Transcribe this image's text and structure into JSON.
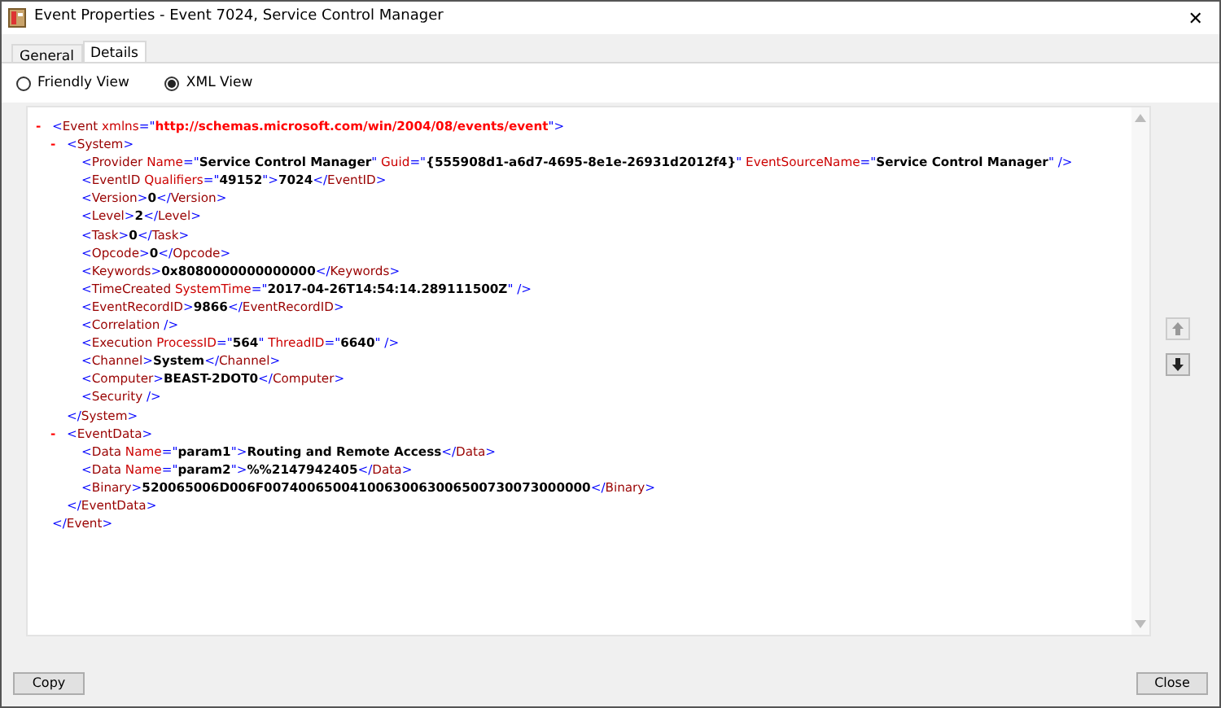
{
  "window": {
    "title": "Event Properties - Event 7024, Service Control Manager",
    "close": "✕"
  },
  "tabs": [
    {
      "label": "General",
      "selected": false
    },
    {
      "label": "Details",
      "selected": true
    }
  ],
  "view_options": [
    {
      "label": "Friendly View",
      "selected": false
    },
    {
      "label": "XML View",
      "selected": true
    }
  ],
  "xml": [
    {
      "toggle": "-",
      "expanded": true,
      "parts": [
        {
          "kind": "punct",
          "text": "<"
        },
        {
          "kind": "tag",
          "text": "Event "
        },
        {
          "kind": "attr",
          "text": "xmlns"
        },
        {
          "kind": "punct",
          "text": "=\""
        },
        {
          "kind": "ns",
          "text": "http://schemas.microsoft.com/win/2004/08/events/event"
        },
        {
          "kind": "punct",
          "text": "\">"
        }
      ],
      "end": [
        {
          "kind": "punct",
          "text": "</"
        },
        {
          "kind": "tag",
          "text": "Event"
        },
        {
          "kind": "punct",
          "text": ">"
        }
      ],
      "children": [
        {
          "toggle": "-",
          "expanded": true,
          "parts": [
            {
              "kind": "punct",
              "text": "<"
            },
            {
              "kind": "tag",
              "text": "System"
            },
            {
              "kind": "punct",
              "text": ">"
            }
          ],
          "end": [
            {
              "kind": "punct",
              "text": "</"
            },
            {
              "kind": "tag",
              "text": "System"
            },
            {
              "kind": "punct",
              "text": ">"
            }
          ],
          "children": [
            {
              "parts": [
                {
                  "kind": "punct",
                  "text": "<"
                },
                {
                  "kind": "tag",
                  "text": "Provider "
                },
                {
                  "kind": "attr",
                  "text": "Name"
                },
                {
                  "kind": "punct",
                  "text": "=\""
                },
                {
                  "kind": "value",
                  "text": "Service Control Manager"
                },
                {
                  "kind": "punct",
                  "text": "\" "
                },
                {
                  "kind": "attr",
                  "text": "Guid"
                },
                {
                  "kind": "punct",
                  "text": "=\""
                },
                {
                  "kind": "value",
                  "text": "{555908d1-a6d7-4695-8e1e-26931d2012f4}"
                },
                {
                  "kind": "punct",
                  "text": "\" "
                },
                {
                  "kind": "attr",
                  "text": "EventSourceName"
                },
                {
                  "kind": "punct",
                  "text": "=\""
                },
                {
                  "kind": "value",
                  "text": "Service Control Manager"
                },
                {
                  "kind": "punct",
                  "text": "\" />"
                }
              ]
            },
            {
              "parts": [
                {
                  "kind": "punct",
                  "text": "<"
                },
                {
                  "kind": "tag",
                  "text": "EventID "
                },
                {
                  "kind": "attr",
                  "text": "Qualifiers"
                },
                {
                  "kind": "punct",
                  "text": "=\""
                },
                {
                  "kind": "value",
                  "text": "49152"
                },
                {
                  "kind": "punct",
                  "text": "\">"
                },
                {
                  "kind": "value",
                  "text": "7024"
                },
                {
                  "kind": "punct",
                  "text": "</"
                },
                {
                  "kind": "tag",
                  "text": "EventID"
                },
                {
                  "kind": "punct",
                  "text": ">"
                }
              ]
            },
            {
              "parts": [
                {
                  "kind": "punct",
                  "text": "<"
                },
                {
                  "kind": "tag",
                  "text": "Version"
                },
                {
                  "kind": "punct",
                  "text": ">"
                },
                {
                  "kind": "value",
                  "text": "0"
                },
                {
                  "kind": "punct",
                  "text": "</"
                },
                {
                  "kind": "tag",
                  "text": "Version"
                },
                {
                  "kind": "punct",
                  "text": ">"
                }
              ]
            },
            {
              "parts": [
                {
                  "kind": "punct",
                  "text": "<"
                },
                {
                  "kind": "tag",
                  "text": "Level"
                },
                {
                  "kind": "punct",
                  "text": ">"
                },
                {
                  "kind": "value",
                  "text": "2"
                },
                {
                  "kind": "punct",
                  "text": "</"
                },
                {
                  "kind": "tag",
                  "text": "Level"
                },
                {
                  "kind": "punct",
                  "text": ">"
                }
              ]
            },
            {
              "parts": [
                {
                  "kind": "punct",
                  "text": "<"
                },
                {
                  "kind": "tag",
                  "text": "Task"
                },
                {
                  "kind": "punct",
                  "text": ">"
                },
                {
                  "kind": "value",
                  "text": "0"
                },
                {
                  "kind": "punct",
                  "text": "</"
                },
                {
                  "kind": "tag",
                  "text": "Task"
                },
                {
                  "kind": "punct",
                  "text": ">"
                }
              ]
            },
            {
              "parts": [
                {
                  "kind": "punct",
                  "text": "<"
                },
                {
                  "kind": "tag",
                  "text": "Opcode"
                },
                {
                  "kind": "punct",
                  "text": ">"
                },
                {
                  "kind": "value",
                  "text": "0"
                },
                {
                  "kind": "punct",
                  "text": "</"
                },
                {
                  "kind": "tag",
                  "text": "Opcode"
                },
                {
                  "kind": "punct",
                  "text": ">"
                }
              ]
            },
            {
              "parts": [
                {
                  "kind": "punct",
                  "text": "<"
                },
                {
                  "kind": "tag",
                  "text": "Keywords"
                },
                {
                  "kind": "punct",
                  "text": ">"
                },
                {
                  "kind": "value",
                  "text": "0x8080000000000000"
                },
                {
                  "kind": "punct",
                  "text": "</"
                },
                {
                  "kind": "tag",
                  "text": "Keywords"
                },
                {
                  "kind": "punct",
                  "text": ">"
                }
              ]
            },
            {
              "parts": [
                {
                  "kind": "punct",
                  "text": "<"
                },
                {
                  "kind": "tag",
                  "text": "TimeCreated "
                },
                {
                  "kind": "attr",
                  "text": "SystemTime"
                },
                {
                  "kind": "punct",
                  "text": "=\""
                },
                {
                  "kind": "value",
                  "text": "2017-04-26T14:54:14.289111500Z"
                },
                {
                  "kind": "punct",
                  "text": "\" />"
                }
              ]
            },
            {
              "parts": [
                {
                  "kind": "punct",
                  "text": "<"
                },
                {
                  "kind": "tag",
                  "text": "EventRecordID"
                },
                {
                  "kind": "punct",
                  "text": ">"
                },
                {
                  "kind": "value",
                  "text": "9866"
                },
                {
                  "kind": "punct",
                  "text": "</"
                },
                {
                  "kind": "tag",
                  "text": "EventRecordID"
                },
                {
                  "kind": "punct",
                  "text": ">"
                }
              ]
            },
            {
              "parts": [
                {
                  "kind": "punct",
                  "text": "<"
                },
                {
                  "kind": "tag",
                  "text": "Correlation "
                },
                {
                  "kind": "punct",
                  "text": "/>"
                }
              ]
            },
            {
              "parts": [
                {
                  "kind": "punct",
                  "text": "<"
                },
                {
                  "kind": "tag",
                  "text": "Execution "
                },
                {
                  "kind": "attr",
                  "text": "ProcessID"
                },
                {
                  "kind": "punct",
                  "text": "=\""
                },
                {
                  "kind": "value",
                  "text": "564"
                },
                {
                  "kind": "punct",
                  "text": "\" "
                },
                {
                  "kind": "attr",
                  "text": "ThreadID"
                },
                {
                  "kind": "punct",
                  "text": "=\""
                },
                {
                  "kind": "value",
                  "text": "6640"
                },
                {
                  "kind": "punct",
                  "text": "\" />"
                }
              ]
            },
            {
              "parts": [
                {
                  "kind": "punct",
                  "text": "<"
                },
                {
                  "kind": "tag",
                  "text": "Channel"
                },
                {
                  "kind": "punct",
                  "text": ">"
                },
                {
                  "kind": "value",
                  "text": "System"
                },
                {
                  "kind": "punct",
                  "text": "</"
                },
                {
                  "kind": "tag",
                  "text": "Channel"
                },
                {
                  "kind": "punct",
                  "text": ">"
                }
              ]
            },
            {
              "parts": [
                {
                  "kind": "punct",
                  "text": "<"
                },
                {
                  "kind": "tag",
                  "text": "Computer"
                },
                {
                  "kind": "punct",
                  "text": ">"
                },
                {
                  "kind": "value",
                  "text": "BEAST-2DOT0"
                },
                {
                  "kind": "punct",
                  "text": "</"
                },
                {
                  "kind": "tag",
                  "text": "Computer"
                },
                {
                  "kind": "punct",
                  "text": ">"
                }
              ]
            },
            {
              "parts": [
                {
                  "kind": "punct",
                  "text": "<"
                },
                {
                  "kind": "tag",
                  "text": "Security "
                },
                {
                  "kind": "punct",
                  "text": "/>"
                }
              ]
            }
          ]
        },
        {
          "toggle": "-",
          "expanded": true,
          "parts": [
            {
              "kind": "punct",
              "text": "<"
            },
            {
              "kind": "tag",
              "text": "EventData"
            },
            {
              "kind": "punct",
              "text": ">"
            }
          ],
          "end": [
            {
              "kind": "punct",
              "text": "</"
            },
            {
              "kind": "tag",
              "text": "EventData"
            },
            {
              "kind": "punct",
              "text": ">"
            }
          ],
          "children": [
            {
              "parts": [
                {
                  "kind": "punct",
                  "text": "<"
                },
                {
                  "kind": "tag",
                  "text": "Data "
                },
                {
                  "kind": "attr",
                  "text": "Name"
                },
                {
                  "kind": "punct",
                  "text": "=\""
                },
                {
                  "kind": "value",
                  "text": "param1"
                },
                {
                  "kind": "punct",
                  "text": "\">"
                },
                {
                  "kind": "value",
                  "text": "Routing and Remote Access"
                },
                {
                  "kind": "punct",
                  "text": "</"
                },
                {
                  "kind": "tag",
                  "text": "Data"
                },
                {
                  "kind": "punct",
                  "text": ">"
                }
              ]
            },
            {
              "parts": [
                {
                  "kind": "punct",
                  "text": "<"
                },
                {
                  "kind": "tag",
                  "text": "Data "
                },
                {
                  "kind": "attr",
                  "text": "Name"
                },
                {
                  "kind": "punct",
                  "text": "=\""
                },
                {
                  "kind": "value",
                  "text": "param2"
                },
                {
                  "kind": "punct",
                  "text": "\">"
                },
                {
                  "kind": "value",
                  "text": "%%2147942405"
                },
                {
                  "kind": "punct",
                  "text": "</"
                },
                {
                  "kind": "tag",
                  "text": "Data"
                },
                {
                  "kind": "punct",
                  "text": ">"
                }
              ]
            },
            {
              "parts": [
                {
                  "kind": "punct",
                  "text": "<"
                },
                {
                  "kind": "tag",
                  "text": "Binary"
                },
                {
                  "kind": "punct",
                  "text": ">"
                },
                {
                  "kind": "value",
                  "text": "520065006D006F00740065004100630063006500730073000000"
                },
                {
                  "kind": "punct",
                  "text": "</"
                },
                {
                  "kind": "tag",
                  "text": "Binary"
                },
                {
                  "kind": "punct",
                  "text": ">"
                }
              ]
            }
          ]
        }
      ]
    }
  ],
  "buttons": [
    "Copy",
    "Close"
  ]
}
